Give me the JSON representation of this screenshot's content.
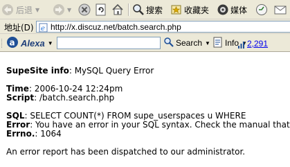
{
  "toolbar": {
    "back_label": "后退",
    "search_label": "搜索",
    "favorites_label": "收藏夹",
    "media_label": "媒体"
  },
  "address": {
    "label": "地址(D)",
    "url": "http://x.discuz.net/batch.search.php"
  },
  "alexa": {
    "brand": "Alexa",
    "search_value": "",
    "search_button": "Search",
    "info_button": "Info",
    "rank": "2,291"
  },
  "page": {
    "line1_label": "SupeSite info",
    "line1_value": ": MySQL Query Error",
    "time_label": "Time",
    "time_value": ": 2006-10-24 12:24pm",
    "script_label": "Script",
    "script_value": ": /batch.search.php",
    "sql_label": "SQL",
    "sql_value": ": SELECT COUNT(*) FROM supe_userspaces u WHERE",
    "error_label": "Error",
    "error_value": ": You have an error in your SQL syntax. Check the manual that co",
    "errno_label": "Errno.",
    "errno_value": ": 1064",
    "footer": "An error report has been dispatched to our administrator."
  },
  "colors": {
    "chrome": "#ece9d8",
    "link": "#0000ee",
    "ie_blue": "#1e6fd9"
  }
}
